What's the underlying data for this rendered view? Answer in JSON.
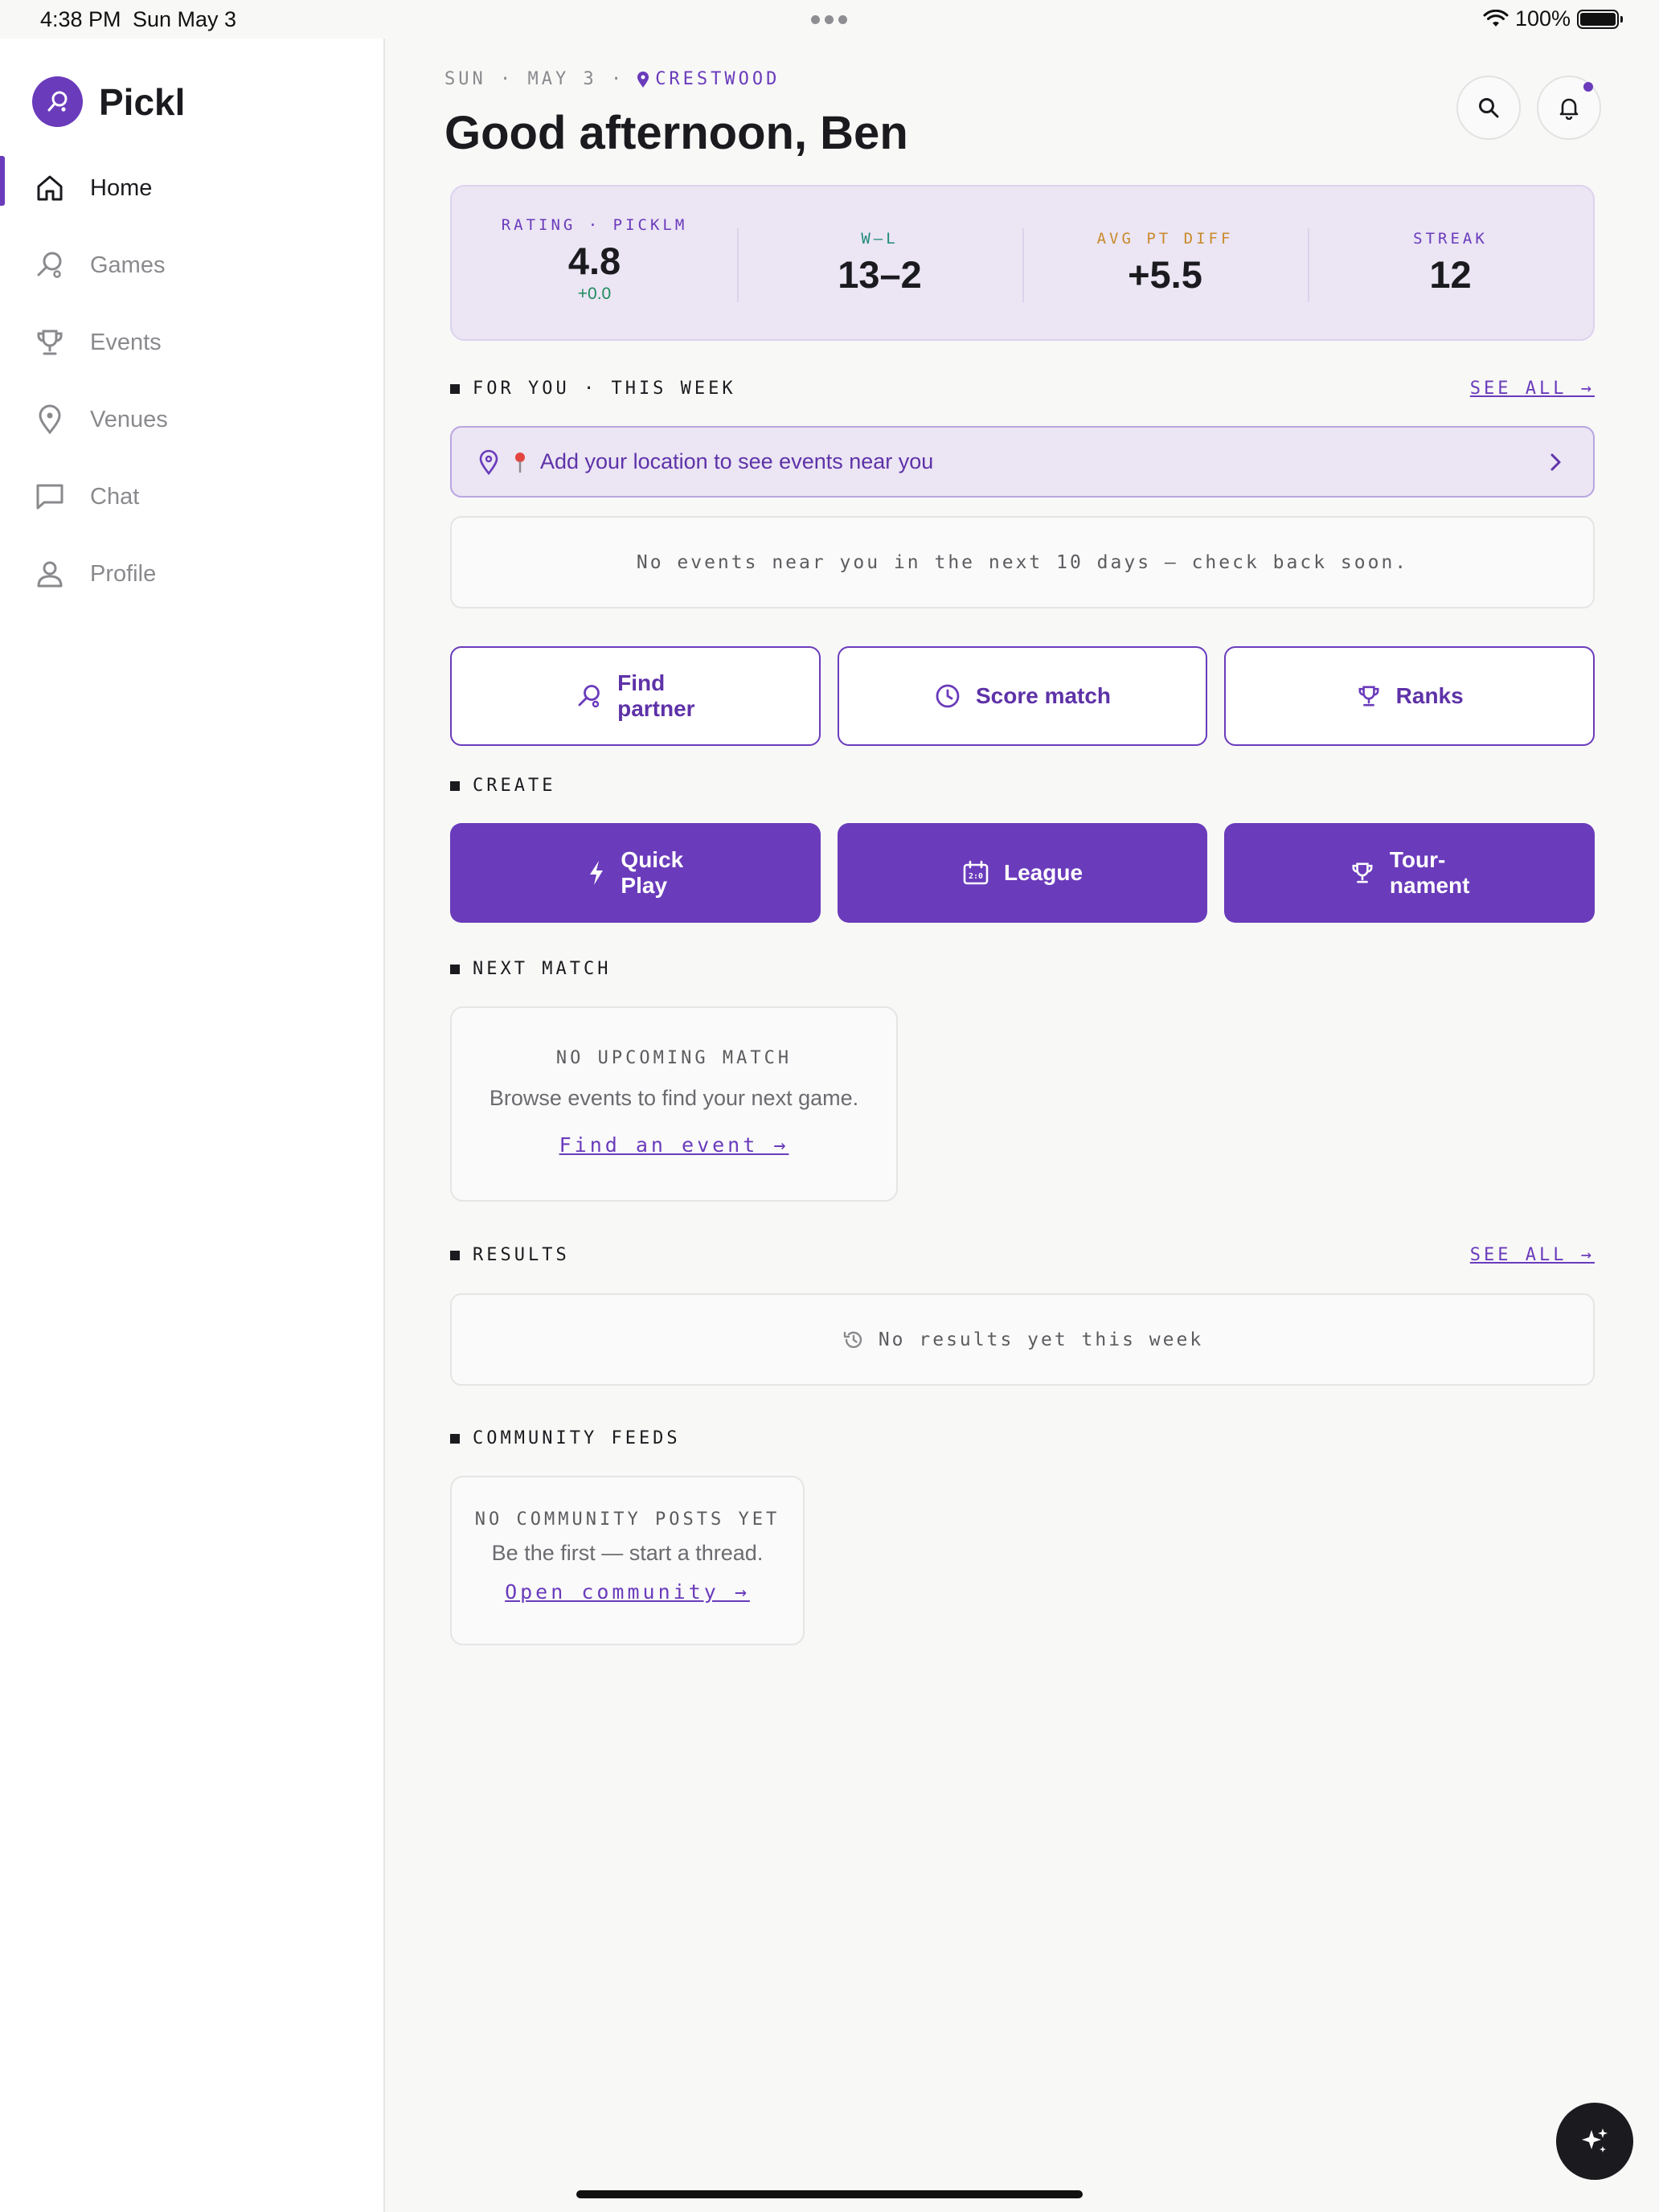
{
  "status_bar": {
    "time": "4:38 PM",
    "date": "Sun May 3",
    "battery": "100%"
  },
  "sidebar": {
    "app_name": "Pickl",
    "items": [
      {
        "label": "Home",
        "icon": "home-icon",
        "active": true
      },
      {
        "label": "Games",
        "icon": "paddle-icon",
        "active": false
      },
      {
        "label": "Events",
        "icon": "trophy-icon",
        "active": false
      },
      {
        "label": "Venues",
        "icon": "map-pin-icon",
        "active": false
      },
      {
        "label": "Chat",
        "icon": "chat-icon",
        "active": false
      },
      {
        "label": "Profile",
        "icon": "user-icon",
        "active": false
      }
    ]
  },
  "header": {
    "date_line": "SUN · MAY 3 ·",
    "location": "CRESTWOOD",
    "greeting": "Good afternoon, Ben"
  },
  "stats": [
    {
      "label": "RATING · PICKLM",
      "value": "4.8",
      "sub": "+0.0",
      "color": "#6a3bbb"
    },
    {
      "label": "W–L",
      "value": "13–2",
      "sub": "",
      "color": "#1f8a7a"
    },
    {
      "label": "AVG PT DIFF",
      "value": "+5.5",
      "sub": "",
      "color": "#c98a2b"
    },
    {
      "label": "STREAK",
      "value": "12",
      "sub": "",
      "color": "#6a3bbb"
    }
  ],
  "for_you": {
    "title": "FOR YOU · THIS WEEK",
    "see_all": "SEE ALL →",
    "location_prompt": "Add your location to see events near you",
    "empty": "No events near you in the next 10 days — check back soon."
  },
  "quick_actions": [
    {
      "label_line1": "Find",
      "label_line2": "partner",
      "icon": "paddle-icon"
    },
    {
      "label_line1": "Score match",
      "label_line2": "",
      "icon": "clock-icon"
    },
    {
      "label_line1": "Ranks",
      "label_line2": "",
      "icon": "trophy-icon"
    }
  ],
  "create": {
    "title": "CREATE",
    "buttons": [
      {
        "label_line1": "Quick",
        "label_line2": "Play",
        "icon": "bolt-icon"
      },
      {
        "label_line1": "League",
        "label_line2": "",
        "icon": "scoreboard-icon"
      },
      {
        "label_line1": "Tour-",
        "label_line2": "nament",
        "icon": "trophy-icon"
      }
    ]
  },
  "next_match": {
    "title": "NEXT MATCH",
    "caption": "NO UPCOMING MATCH",
    "text": "Browse events to find your next game.",
    "link": "Find an event →"
  },
  "results": {
    "title": "RESULTS",
    "see_all": "SEE ALL →",
    "empty": "No results yet this week"
  },
  "community": {
    "title": "COMMUNITY FEEDS",
    "caption": "NO COMMUNITY POSTS YET",
    "text": "Be the first — start a thread.",
    "link": "Open community →"
  },
  "colors": {
    "accent": "#6a3bbb",
    "accent_light": "#ebe5f4",
    "positive": "#1f8a5c"
  }
}
